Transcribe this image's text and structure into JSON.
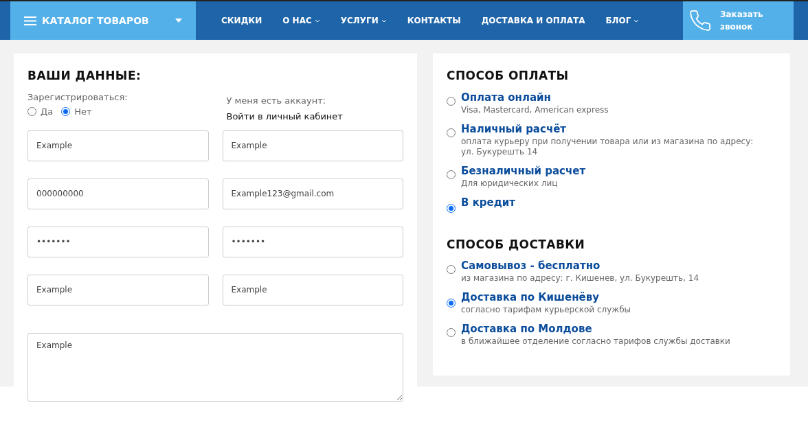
{
  "header": {
    "catalog": "КАТАЛОГ ТОВАРОВ",
    "nav": [
      {
        "label": "СКИДКИ",
        "has_dropdown": false
      },
      {
        "label": "О НАС",
        "has_dropdown": true
      },
      {
        "label": "УСЛУГИ",
        "has_dropdown": true
      },
      {
        "label": "КОНТАКТЫ",
        "has_dropdown": false
      },
      {
        "label": "ДОСТАВКА И ОПЛАТА",
        "has_dropdown": false
      },
      {
        "label": "БЛОГ",
        "has_dropdown": true
      }
    ],
    "callback": "Заказать звонок"
  },
  "your_data": {
    "title": "ВАШИ ДАННЫЕ:",
    "register_label": "Зарегистрироваться:",
    "register_options": [
      {
        "label": "Да",
        "selected": false
      },
      {
        "label": "Нет",
        "selected": true
      }
    ],
    "account_label": "У меня есть аккаунт:",
    "login_link": "Войти в личный кабинет",
    "fields": [
      {
        "value": "Example"
      },
      {
        "value": "Example"
      },
      {
        "value": "000000000"
      },
      {
        "value": "Example123@gmail.com"
      },
      {
        "value": "•••••••"
      },
      {
        "value": "•••••••"
      },
      {
        "value": "Example"
      },
      {
        "value": "Example"
      }
    ],
    "comment": "Example"
  },
  "payment": {
    "title": "СПОСОБ ОПЛАТЫ",
    "options": [
      {
        "label": "Оплата онлайн",
        "note": "Visa, Mastercard, American express",
        "selected": false
      },
      {
        "label": "Наличный расчёт",
        "note": "оплата курьеру при получении товара или из магазина по адресу: ул. Букурешть 14",
        "selected": false
      },
      {
        "label": "Безналичный расчет",
        "note": "Для юридических лиц",
        "selected": false
      },
      {
        "label": "В кредит",
        "selected": true
      }
    ]
  },
  "delivery": {
    "title": "СПОСОБ ДОСТАВКИ",
    "options": [
      {
        "label": "Самовывоз - бесплатно",
        "note": "из магазина по адресу: г. Кишенев, ул. Букурешть, 14",
        "selected": false
      },
      {
        "label": "Доставка по Кишенёву",
        "note": "согласно тарифам курьерской службы",
        "selected": true
      },
      {
        "label": "Доставка по Молдове",
        "note": "в ближайшее отделение согласно тарифов службы доставки",
        "selected": false
      }
    ]
  }
}
